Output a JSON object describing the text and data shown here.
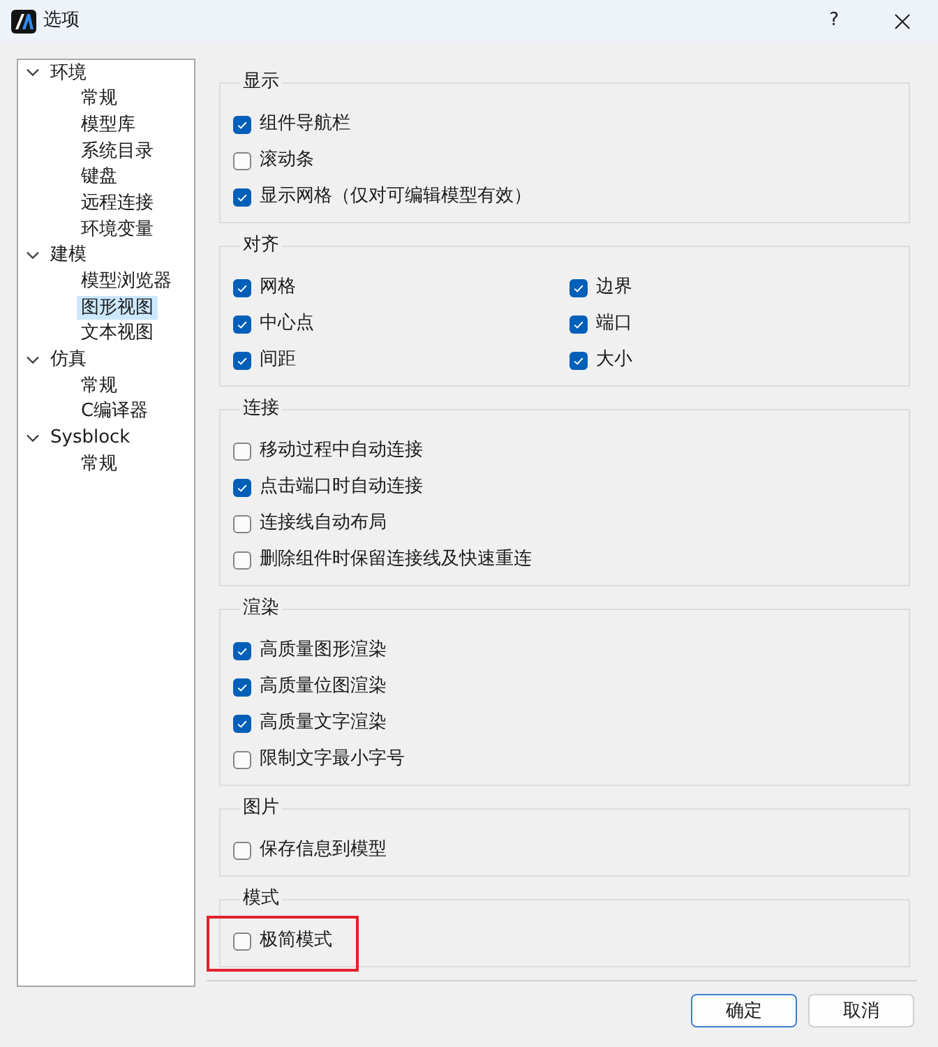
{
  "window": {
    "title": "选项",
    "help": "?"
  },
  "tree": [
    {
      "label": "环境",
      "expanded": true,
      "selected": false,
      "children": [
        {
          "label": "常规",
          "selected": false
        },
        {
          "label": "模型库",
          "selected": false
        },
        {
          "label": "系统目录",
          "selected": false
        },
        {
          "label": "键盘",
          "selected": false
        },
        {
          "label": "远程连接",
          "selected": false
        },
        {
          "label": "环境变量",
          "selected": false
        }
      ]
    },
    {
      "label": "建模",
      "expanded": true,
      "selected": false,
      "children": [
        {
          "label": "模型浏览器",
          "selected": false
        },
        {
          "label": "图形视图",
          "selected": true
        },
        {
          "label": "文本视图",
          "selected": false
        }
      ]
    },
    {
      "label": "仿真",
      "expanded": true,
      "selected": false,
      "children": [
        {
          "label": "常规",
          "selected": false
        },
        {
          "label": "C编译器",
          "selected": false
        }
      ]
    },
    {
      "label": "Sysblock",
      "expanded": true,
      "selected": false,
      "children": [
        {
          "label": "常规",
          "selected": false
        }
      ]
    }
  ],
  "groups": [
    {
      "title": "显示",
      "kind": "list",
      "options": [
        {
          "label": "组件导航栏",
          "checked": true,
          "highlighted": false
        },
        {
          "label": "滚动条",
          "checked": false,
          "highlighted": false
        },
        {
          "label": "显示网格（仅对可编辑模型有效）",
          "checked": true,
          "highlighted": false
        }
      ]
    },
    {
      "title": "对齐",
      "kind": "grid",
      "options": [
        {
          "label": "网格",
          "checked": true,
          "highlighted": false
        },
        {
          "label": "边界",
          "checked": true,
          "highlighted": false
        },
        {
          "label": "中心点",
          "checked": true,
          "highlighted": false
        },
        {
          "label": "端口",
          "checked": true,
          "highlighted": false
        },
        {
          "label": "间距",
          "checked": true,
          "highlighted": false
        },
        {
          "label": "大小",
          "checked": true,
          "highlighted": false
        }
      ]
    },
    {
      "title": "连接",
      "kind": "list",
      "options": [
        {
          "label": "移动过程中自动连接",
          "checked": false,
          "highlighted": false
        },
        {
          "label": "点击端口时自动连接",
          "checked": true,
          "highlighted": false
        },
        {
          "label": "连接线自动布局",
          "checked": false,
          "highlighted": false
        },
        {
          "label": "删除组件时保留连接线及快速重连",
          "checked": false,
          "highlighted": false
        }
      ]
    },
    {
      "title": "渲染",
      "kind": "list",
      "options": [
        {
          "label": "高质量图形渲染",
          "checked": true,
          "highlighted": false
        },
        {
          "label": "高质量位图渲染",
          "checked": true,
          "highlighted": false
        },
        {
          "label": "高质量文字渲染",
          "checked": true,
          "highlighted": false
        },
        {
          "label": "限制文字最小字号",
          "checked": false,
          "highlighted": false
        }
      ]
    },
    {
      "title": "图片",
      "kind": "list",
      "options": [
        {
          "label": "保存信息到模型",
          "checked": false,
          "highlighted": false
        }
      ]
    },
    {
      "title": "模式",
      "kind": "list",
      "options": [
        {
          "label": "极简模式",
          "checked": false,
          "highlighted": true
        }
      ]
    }
  ],
  "buttons": [
    {
      "label": "确定",
      "default": true
    },
    {
      "label": "取消",
      "default": false
    }
  ]
}
